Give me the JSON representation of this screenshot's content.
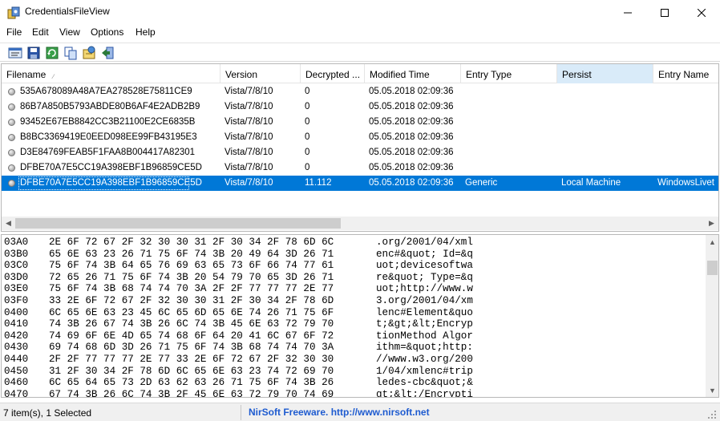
{
  "window": {
    "title": "CredentialsFileView",
    "app_icon": "credentialsfileview-app-icon",
    "controls": {
      "minimize": "minimize-icon",
      "maximize": "maximize-icon",
      "close": "close-icon"
    }
  },
  "menu": [
    "File",
    "Edit",
    "View",
    "Options",
    "Help"
  ],
  "toolbar": [
    {
      "icon": "properties-icon"
    },
    {
      "icon": "save-icon"
    },
    {
      "icon": "refresh-icon"
    },
    {
      "icon": "copy-icon"
    },
    {
      "icon": "html-report-icon"
    },
    {
      "icon": "exit-icon"
    }
  ],
  "list": {
    "columns": [
      "Filename",
      "Version",
      "Decrypted ...",
      "Modified Time",
      "Entry Type",
      "Persist",
      "Entry Name"
    ],
    "sorted_column": "Filename",
    "highlighted_column": "Persist",
    "rows": [
      {
        "filename": "535A678089A48A7EA278528E75811CE9",
        "version": "Vista/7/8/10",
        "decrypted": "0",
        "modified": "05.05.2018 02:09:36",
        "entry_type": "",
        "persist": "",
        "entry_name": ""
      },
      {
        "filename": "86B7A850B5793ABDE80B6AF4E2ADB2B9",
        "version": "Vista/7/8/10",
        "decrypted": "0",
        "modified": "05.05.2018 02:09:36",
        "entry_type": "",
        "persist": "",
        "entry_name": ""
      },
      {
        "filename": "93452E67EB8842CC3B21100E2CE6835B",
        "version": "Vista/7/8/10",
        "decrypted": "0",
        "modified": "05.05.2018 02:09:36",
        "entry_type": "",
        "persist": "",
        "entry_name": ""
      },
      {
        "filename": "B8BC3369419E0EED098EE99FB43195E3",
        "version": "Vista/7/8/10",
        "decrypted": "0",
        "modified": "05.05.2018 02:09:36",
        "entry_type": "",
        "persist": "",
        "entry_name": ""
      },
      {
        "filename": "D3E84769FEAB5F1FAA8B004417A82301",
        "version": "Vista/7/8/10",
        "decrypted": "0",
        "modified": "05.05.2018 02:09:36",
        "entry_type": "",
        "persist": "",
        "entry_name": ""
      },
      {
        "filename": "DFBE70A7E5CC19A398EBF1B96859CE5D",
        "version": "Vista/7/8/10",
        "decrypted": "0",
        "modified": "05.05.2018 02:09:36",
        "entry_type": "",
        "persist": "",
        "entry_name": ""
      },
      {
        "filename": "DFBE70A7E5CC19A398EBF1B96859CE5D",
        "version": "Vista/7/8/10",
        "decrypted": "11.112",
        "modified": "05.05.2018 02:09:36",
        "entry_type": "Generic",
        "persist": "Local Machine",
        "entry_name": "WindowsLivet",
        "selected": true
      }
    ]
  },
  "hex": [
    {
      "offset": "03A0",
      "bytes": "2E 6F 72 67 2F 32 30 30 31 2F 30 34 2F 78 6D 6C",
      "ascii": ".org/2001/04/xml"
    },
    {
      "offset": "03B0",
      "bytes": "65 6E 63 23 26 71 75 6F 74 3B 20 49 64 3D 26 71",
      "ascii": "enc#&quot; Id=&q"
    },
    {
      "offset": "03C0",
      "bytes": "75 6F 74 3B 64 65 76 69 63 65 73 6F 66 74 77 61",
      "ascii": "uot;devicesoftwa"
    },
    {
      "offset": "03D0",
      "bytes": "72 65 26 71 75 6F 74 3B 20 54 79 70 65 3D 26 71",
      "ascii": "re&quot; Type=&q"
    },
    {
      "offset": "03E0",
      "bytes": "75 6F 74 3B 68 74 74 70 3A 2F 2F 77 77 77 2E 77",
      "ascii": "uot;http://www.w"
    },
    {
      "offset": "03F0",
      "bytes": "33 2E 6F 72 67 2F 32 30 30 31 2F 30 34 2F 78 6D",
      "ascii": "3.org/2001/04/xm"
    },
    {
      "offset": "0400",
      "bytes": "6C 65 6E 63 23 45 6C 65 6D 65 6E 74 26 71 75 6F",
      "ascii": "lenc#Element&quo"
    },
    {
      "offset": "0410",
      "bytes": "74 3B 26 67 74 3B 26 6C 74 3B 45 6E 63 72 79 70",
      "ascii": "t;&gt;&lt;Encryp"
    },
    {
      "offset": "0420",
      "bytes": "74 69 6F 6E 4D 65 74 68 6F 64 20 41 6C 67 6F 72",
      "ascii": "tionMethod Algor"
    },
    {
      "offset": "0430",
      "bytes": "69 74 68 6D 3D 26 71 75 6F 74 3B 68 74 74 70 3A",
      "ascii": "ithm=&quot;http:"
    },
    {
      "offset": "0440",
      "bytes": "2F 2F 77 77 77 2E 77 33 2E 6F 72 67 2F 32 30 30",
      "ascii": "//www.w3.org/200"
    },
    {
      "offset": "0450",
      "bytes": "31 2F 30 34 2F 78 6D 6C 65 6E 63 23 74 72 69 70",
      "ascii": "1/04/xmlenc#trip"
    },
    {
      "offset": "0460",
      "bytes": "6C 65 64 65 73 2D 63 62 63 26 71 75 6F 74 3B 26",
      "ascii": "ledes-cbc&quot;&"
    },
    {
      "offset": "0470",
      "bytes": "67 74 3B 26 6C 74 3B 2F 45 6E 63 72 79 70 74 69",
      "ascii": "gt;&lt;/Encrypti"
    }
  ],
  "status": {
    "left": "7 item(s), 1 Selected",
    "link": "NirSoft Freeware.  http://www.nirsoft.net"
  },
  "colors": {
    "selection": "#0078d7",
    "highlight_column": "#d9ebf9",
    "link": "#1e5bd0"
  }
}
